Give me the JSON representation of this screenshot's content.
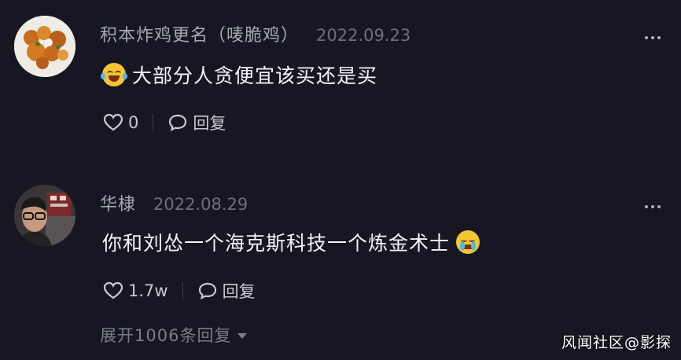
{
  "comments": [
    {
      "username": "积本炸鸡更名（唛脆鸡）",
      "date": "2022.09.23",
      "text": "大部分人贪便宜该买还是买",
      "likes": "0",
      "reply_label": "回复"
    },
    {
      "username": "华棣",
      "date": "2022.08.29",
      "text": "你和刘怂一个海克斯科技一个炼金术士",
      "likes": "1.7w",
      "reply_label": "回复",
      "expand_label": "展开1006条回复"
    }
  ],
  "watermark": "风闻社区@影探"
}
